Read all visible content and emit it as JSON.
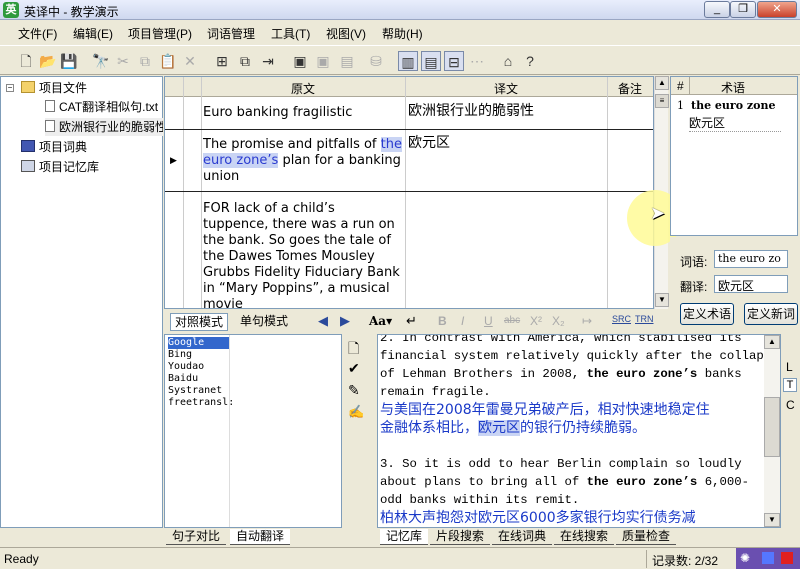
{
  "titlebar": {
    "title": "英译中 - 教学演示",
    "app_icon": "英",
    "minimize": "_",
    "restore": "❐",
    "close": "✕"
  },
  "menu": [
    "文件(F)",
    "编辑(E)",
    "项目管理(P)",
    "词语管理",
    "工具(T)",
    "视图(V)",
    "帮助(H)"
  ],
  "tree": {
    "items": [
      {
        "label": "项目文件"
      },
      {
        "label": "CAT翻译相似句.txt"
      },
      {
        "label": "欧洲银行业的脆弱性"
      },
      {
        "label": "项目词典"
      },
      {
        "label": "项目记忆库"
      }
    ]
  },
  "grid": {
    "headers": {
      "source": "原文",
      "target": "译文",
      "note": "备注"
    },
    "rows": [
      {
        "source": "Euro banking fragilistic",
        "target": "欧洲银行业的脆弱性"
      },
      {
        "source_pre": "The promise and pitfalls of",
        "source_hl": "the euro zone’s",
        "source_post": " plan for a banking union",
        "target": "欧元区"
      },
      {
        "source": "FOR lack of a child’s tuppence, there was a run on the bank. So goes the tale of the Dawes Tomes Mousley Grubbs Fidelity Fiduciary Bank in “Mary Poppins”, a musical movie",
        "target": ""
      }
    ]
  },
  "terms": {
    "headers": {
      "num": "#",
      "term": "术语"
    },
    "entry_num": "1",
    "entry_term": "the euro zone",
    "entry_translation": "欧元区",
    "word_label": "词语:",
    "word_value": "the euro zo",
    "translation_label": "翻译:",
    "translation_value": "欧元区",
    "define_term_button": "定义术语",
    "define_new_button": "定义新词"
  },
  "modebar": {
    "tab_parallel": "对照模式",
    "tab_single": "单句模式",
    "font_label": "Aa▾",
    "src_label": "SRC",
    "trn_label": "TRN"
  },
  "engines": [
    "Google",
    "Bing",
    "Youdao",
    "Baidu",
    "Systranet",
    "freetransl:"
  ],
  "memory": {
    "line1": "2.      In contrast with America, which stabilised its",
    "line2": "financial system relatively quickly after the collapse",
    "line3a": "of Lehman Brothers in 2008, ",
    "line3b": "the euro zone’s",
    "line3c": " banks",
    "line4": "remain fragile.",
    "cn1": "      与美国在2008年雷曼兄弟破产后，相对快速地稳定住",
    "cn2a": "金融体系相比，",
    "cn2b": "欧元区",
    "cn2c": "的银行仍持续脆弱。",
    "line6": "3.      So it is odd to hear Berlin complain so loudly",
    "line7a": "about plans to bring all of ",
    "line7b": "the euro zone’s",
    "line7c": " 6,000-",
    "line8": "odd banks within its remit.",
    "cn3": "      柏林大声抱怨对欧元区6000多家银行均实行债务减"
  },
  "side_letters": [
    "L",
    "T",
    "C"
  ],
  "bottom_tabs_left": [
    "句子对比",
    "自动翻译"
  ],
  "bottom_tabs_right": [
    "记忆库",
    "片段搜索",
    "在线词典",
    "在线搜索",
    "质量检查"
  ],
  "status": {
    "ready": "Ready",
    "records": "记录数: 2/32"
  },
  "colors": {
    "highlight": "#c9d4f4",
    "accent": "#2a3bd0",
    "chinese_text": "#1a39c8"
  }
}
